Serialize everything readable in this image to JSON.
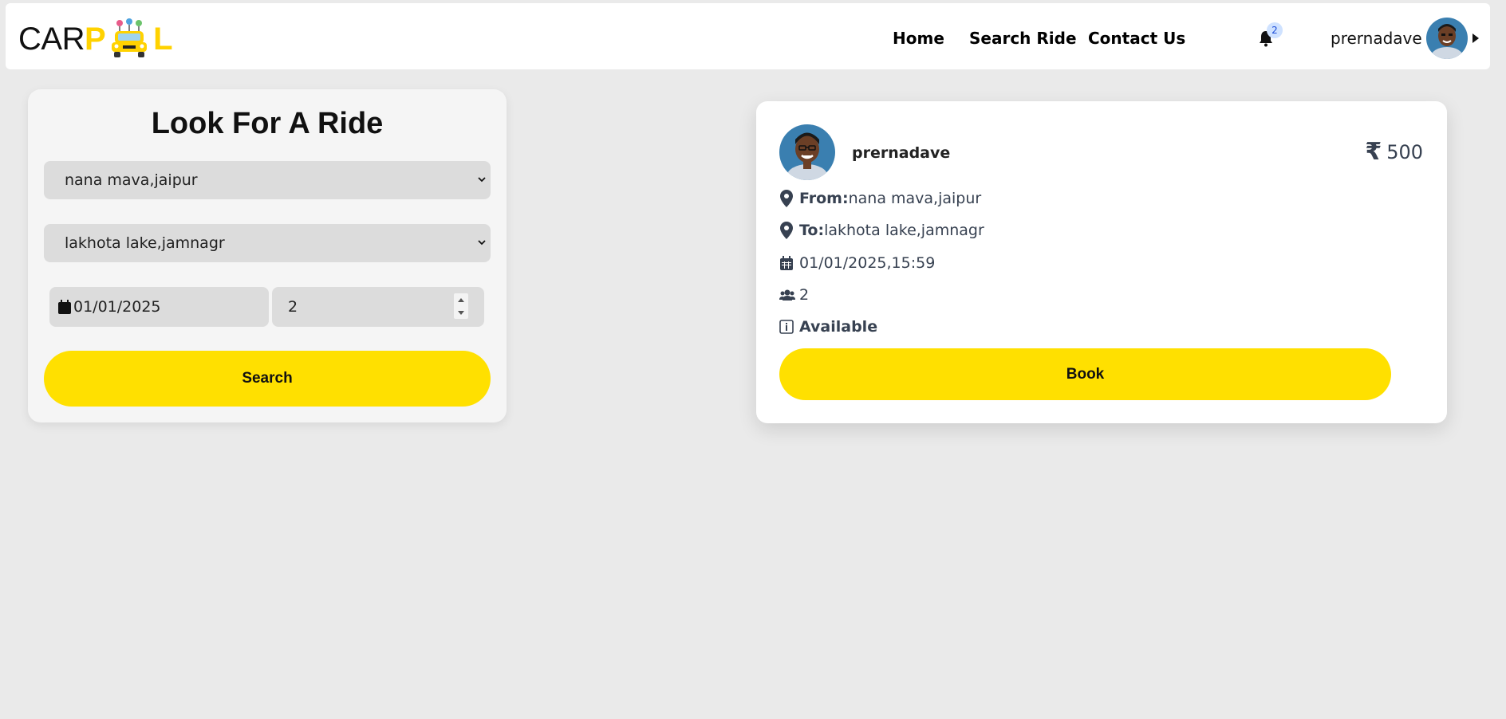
{
  "brand": {
    "logo_prefix": "CAR",
    "logo_p": "P",
    "logo_suffix": "L"
  },
  "nav": {
    "links": [
      "Home",
      "Search Ride",
      "Contact Us"
    ],
    "notification_count": "2",
    "username": "prernadave"
  },
  "search": {
    "title": "Look For A Ride",
    "from_value": "nana mava,jaipur",
    "to_value": "lakhota lake,jamnagr",
    "date_value": "01/01/2025",
    "seats_value": "2",
    "button_label": "Search"
  },
  "ride": {
    "driver_name": "prernadave",
    "price": "500",
    "from_label": "From:",
    "from_value": "nana mava,jaipur",
    "to_label": "To:",
    "to_value": "lakhota lake,jamnagr",
    "datetime": "01/01/2025,15:59",
    "seats": "2",
    "status": "Available",
    "book_label": "Book"
  },
  "colors": {
    "accent_yellow": "#ffe000",
    "background": "#eaeaea",
    "card": "#ffffff",
    "input_gray": "#dcdcdc"
  },
  "icons": [
    "bell-icon",
    "map-pin-icon",
    "calendar-icon",
    "users-icon",
    "info-icon",
    "rupee-icon",
    "chevron-down-icon",
    "caret-right-icon",
    "taxi-icon"
  ]
}
